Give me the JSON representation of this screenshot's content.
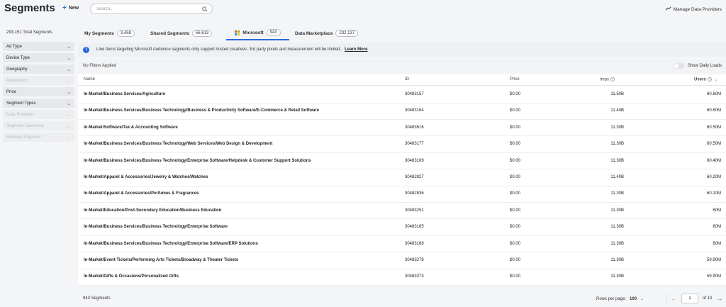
{
  "header": {
    "title": "Segments",
    "new_label": "New",
    "search_placeholder": "Search...",
    "manage_label": "Manage Data Providers"
  },
  "total_segments": "293,151 Total Segments",
  "tabs": [
    {
      "label": "My Segments",
      "count": "3,458",
      "active": false
    },
    {
      "label": "Shared Segments",
      "count": "56,613",
      "active": false
    },
    {
      "label": "Microsoft",
      "count": "943",
      "active": true
    },
    {
      "label": "Data Marketplace",
      "count": "232,137",
      "active": false
    }
  ],
  "sidebar": {
    "filters": [
      {
        "label": "Ad Type",
        "enabled": true
      },
      {
        "label": "Device Type",
        "enabled": true
      },
      {
        "label": "Geography",
        "enabled": true
      },
      {
        "label": "Advertisers",
        "enabled": false
      },
      {
        "label": "Price",
        "enabled": true
      },
      {
        "label": "Segment Types",
        "enabled": true
      },
      {
        "label": "Data Providers",
        "enabled": false
      },
      {
        "label": "Segment Taxonomy",
        "enabled": false
      },
      {
        "label": "Modeled Segment",
        "enabled": false
      }
    ]
  },
  "banner": {
    "text": "Line items targeting Microsoft Audience segments only support hosted creatives. 3rd party pixels and measurement will be limited.",
    "link": "Learn More"
  },
  "filters_bar": {
    "status": "No Filters Applied",
    "toggle_label": "Show Daily Loads",
    "toggle_on": false
  },
  "table": {
    "columns": [
      "Name",
      "ID",
      "Price",
      "Imps",
      "Users"
    ],
    "rows": [
      {
        "name": "In-Market/Business Services/Agriculture",
        "id": "30483157",
        "price": "$0.00",
        "imps": "11.50B",
        "users": "60.60M"
      },
      {
        "name": "In-Market/Business Services/Business Technology/Business & Productivity Software/E-Commerce & Retail Software",
        "id": "30483164",
        "price": "$0.00",
        "imps": "11.40B",
        "users": "60.60M"
      },
      {
        "name": "In-Market/Software/Tax & Accounting Software",
        "id": "30483616",
        "price": "$0.00",
        "imps": "11.30B",
        "users": "60.50M"
      },
      {
        "name": "In-Market/Business Services/Business Technology/Web Services/Web Design & Development",
        "id": "30483177",
        "price": "$0.00",
        "imps": "11.30B",
        "users": "60.50M"
      },
      {
        "name": "In-Market/Business Services/Business Technology/Enterprise Software/Helpdesk & Customer Support Solutions",
        "id": "30483169",
        "price": "$0.00",
        "imps": "11.30B",
        "users": "60.40M"
      },
      {
        "name": "In-Market/Apparel & Accessories/Jewelry & Watches/Watches",
        "id": "30482827",
        "price": "$0.00",
        "imps": "11.40B",
        "users": "60.20M"
      },
      {
        "name": "In-Market/Apparel & Accessories/Perfumes & Fragrances",
        "id": "30482836",
        "price": "$0.00",
        "imps": "11.30B",
        "users": "60.10M"
      },
      {
        "name": "In-Market/Education/Post-Secondary Education/Business Education",
        "id": "30483251",
        "price": "$0.00",
        "imps": "11.30B",
        "users": "60M"
      },
      {
        "name": "In-Market/Business Services/Business Technology/Enterprise Software",
        "id": "30483165",
        "price": "$0.00",
        "imps": "11.30B",
        "users": "60M"
      },
      {
        "name": "In-Market/Business Services/Business Technology/Enterprise Software/ERP Solutions",
        "id": "30483168",
        "price": "$0.00",
        "imps": "11.30B",
        "users": "60M"
      },
      {
        "name": "In-Market/Event Tickets/Performing Arts Tickets/Broadway & Theater Tickets",
        "id": "30483278",
        "price": "$0.00",
        "imps": "11.30B",
        "users": "59.90M"
      },
      {
        "name": "In-Market/Gifts & Occasions/Personalized Gifts",
        "id": "30483373",
        "price": "$0.00",
        "imps": "11.30B",
        "users": "59.90M"
      }
    ]
  },
  "footer": {
    "count": "943 Segments",
    "rows_per_page_label": "Rows per page:",
    "rows_per_page_value": "100",
    "page_value": "1",
    "page_total": "of 10"
  },
  "colors": {
    "accent": "#2a6ad8",
    "background": "#f4f5f7"
  }
}
